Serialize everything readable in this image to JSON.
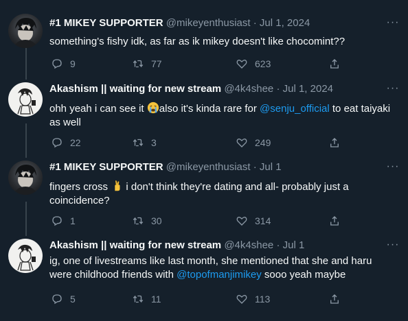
{
  "tweets": [
    {
      "name": "#1 MIKEY SUPPORTER",
      "handle": "@mikeyenthusiast",
      "dot": "·",
      "date": "Jul 1, 2024",
      "text": "something's fishy idk, as far as ik mikey doesn't like chocomint??",
      "replies": "9",
      "retweets": "77",
      "likes": "623"
    },
    {
      "name": "Akashism || waiting for new stream",
      "handle": "@4k4shee",
      "dot": "·",
      "date": "Jul 1, 2024",
      "text_a": "ohh yeah i can see it",
      "text_b": "also it's kinda rare for",
      "mention": "@senju_official",
      "text_c": "to eat taiyaki as well",
      "replies": "22",
      "retweets": "3",
      "likes": "249"
    },
    {
      "name": "#1 MIKEY SUPPORTER",
      "handle": "@mikeyenthusiast",
      "dot": "·",
      "date": "Jul 1",
      "text_a": "fingers cross",
      "text_b": "i don't think they're dating and all- probably just a coincidence?",
      "replies": "1",
      "retweets": "30",
      "likes": "314"
    },
    {
      "name": "Akashism || waiting for new stream",
      "handle": "@4k4shee",
      "dot": "·",
      "date": "Jul 1",
      "text_a": "ig, one of livestreams like last month, she mentioned that she and haru were childhood friends with",
      "mention": "@topofmanjimikey",
      "text_b": "sooo yeah maybe",
      "replies": "5",
      "retweets": "11",
      "likes": "113"
    }
  ],
  "more_label": "···",
  "icons": {
    "reply": "reply-icon",
    "retweet": "retweet-icon",
    "like": "like-icon",
    "share": "share-icon"
  },
  "colors": {
    "background": "#15202b",
    "mention": "#1d9bf0",
    "muted": "#8b98a5"
  }
}
